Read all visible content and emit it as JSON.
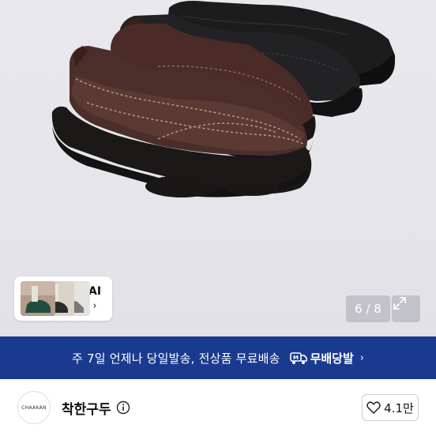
{
  "hero": {
    "image_icon": "shoe-product-photo",
    "counter": "6 / 8",
    "expand_icon": "expand-arrows-icon"
  },
  "ai_chip": {
    "label": "AI",
    "chevron": "›",
    "icon": "chevron-right-icon"
  },
  "banner": {
    "text": "주 7일 언제나 당일발송, 전상품 무료배송",
    "badge_label": "무배당발",
    "badge_icon": "delivery-badge-icon",
    "chevron": "›",
    "background": "#1a3a8f"
  },
  "seller": {
    "avatar_text": "CHAAKAN",
    "name": "착한구두",
    "info_icon": "info-circle-icon",
    "like_icon": "heart-outline-icon",
    "like_count": "4.1만"
  }
}
